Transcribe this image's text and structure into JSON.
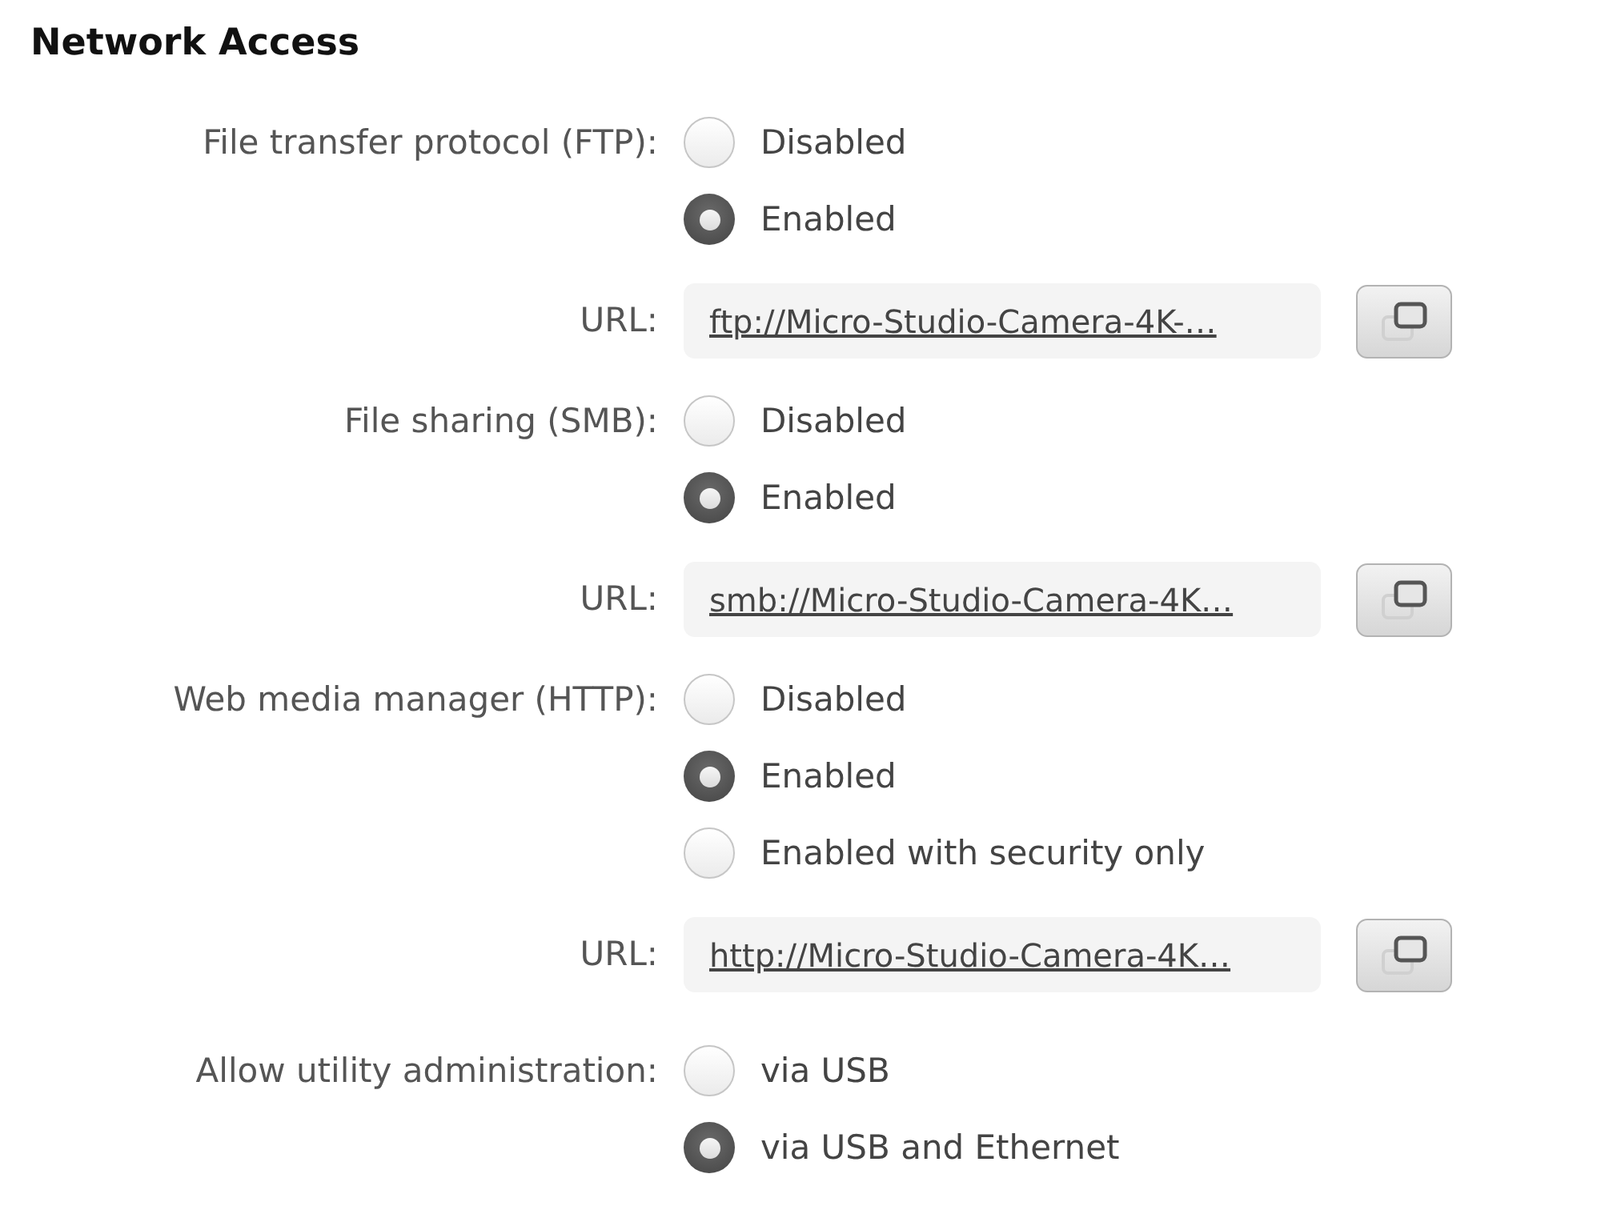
{
  "title": "Network Access",
  "services": [
    {
      "label": "File transfer protocol (FTP):",
      "options": [
        {
          "label": "Disabled",
          "selected": false
        },
        {
          "label": "Enabled",
          "selected": true
        }
      ],
      "url": {
        "label": "URL:",
        "value": "ftp://Micro-Studio-Camera-4K-…"
      }
    },
    {
      "label": "File sharing (SMB):",
      "options": [
        {
          "label": "Disabled",
          "selected": false
        },
        {
          "label": "Enabled",
          "selected": true
        }
      ],
      "url": {
        "label": "URL:",
        "value": "smb://Micro-Studio-Camera-4K…"
      }
    },
    {
      "label": "Web media manager (HTTP):",
      "options": [
        {
          "label": "Disabled",
          "selected": false
        },
        {
          "label": "Enabled",
          "selected": true
        },
        {
          "label": "Enabled with security only",
          "selected": false
        }
      ],
      "url": {
        "label": "URL:",
        "value": "http://Micro-Studio-Camera-4K…"
      }
    }
  ],
  "utility_admin": {
    "label": "Allow utility administration:",
    "options": [
      {
        "label": "via USB",
        "selected": false
      },
      {
        "label": "via USB and Ethernet",
        "selected": true
      }
    ]
  }
}
